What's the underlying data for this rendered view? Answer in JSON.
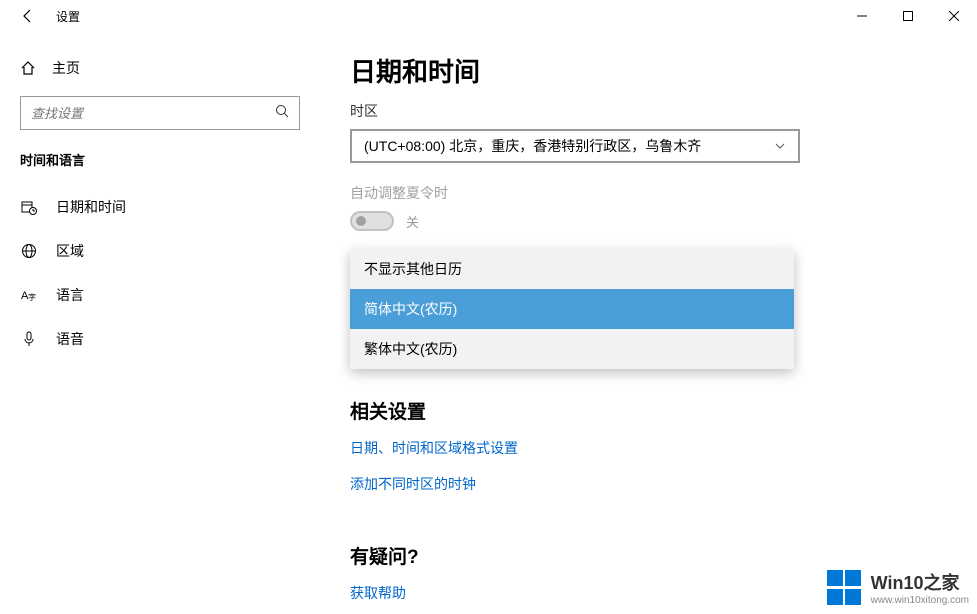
{
  "titlebar": {
    "title": "设置"
  },
  "sidebar": {
    "home": "主页",
    "search_placeholder": "查找设置",
    "category": "时间和语言",
    "items": [
      {
        "label": "日期和时间"
      },
      {
        "label": "区域"
      },
      {
        "label": "语言"
      },
      {
        "label": "语音"
      }
    ]
  },
  "main": {
    "title": "日期和时间",
    "tz_label": "时区",
    "tz_value": "(UTC+08:00) 北京，重庆，香港特别行政区，乌鲁木齐",
    "dst_label": "自动调整夏令时",
    "dst_state": "关",
    "calendar_options": [
      "不显示其他日历",
      "简体中文(农历)",
      "繁体中文(农历)"
    ],
    "related_heading": "相关设置",
    "link1": "日期、时间和区域格式设置",
    "link2": "添加不同时区的时钟",
    "question_heading": "有疑问?",
    "help_link": "获取帮助"
  },
  "watermark": {
    "line1": "Win10之家",
    "line2": "www.win10xitong.com"
  }
}
